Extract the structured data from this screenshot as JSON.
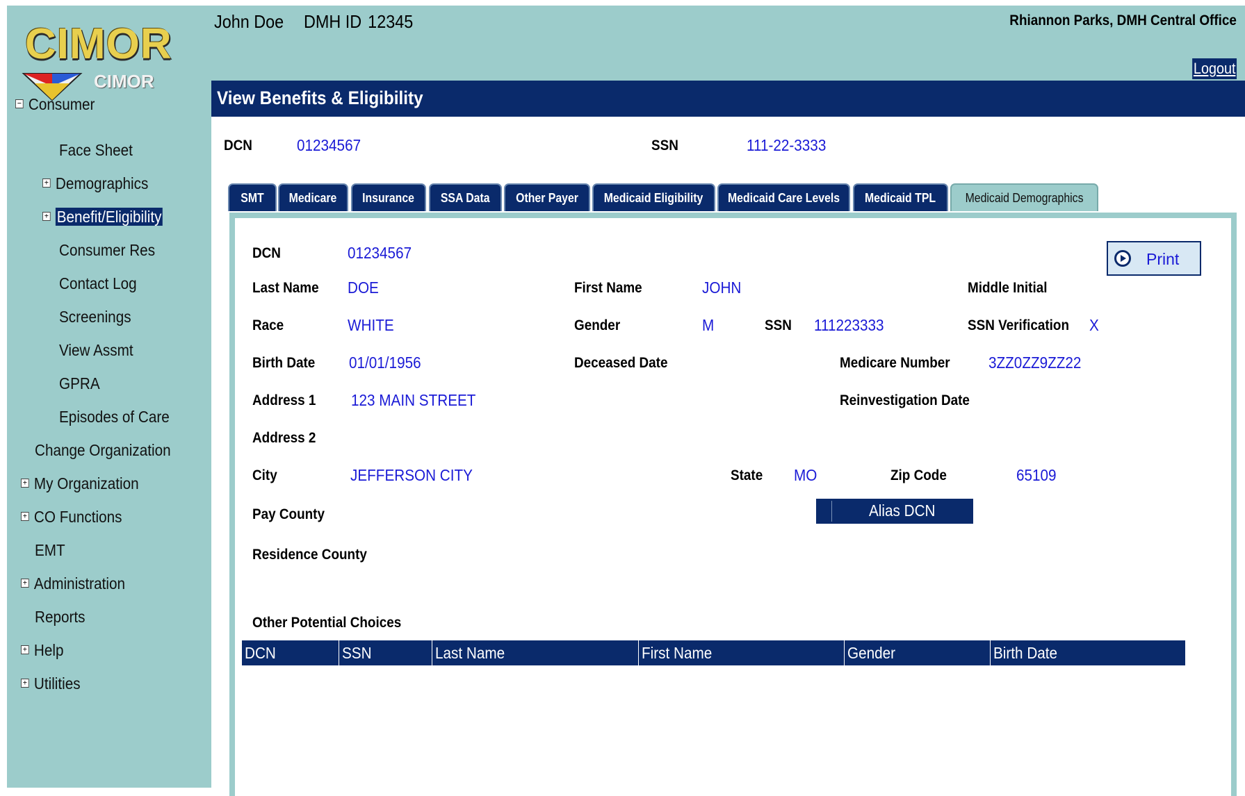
{
  "app": {
    "logo_text": "CIMOR",
    "logo_subtext": "CIMOR"
  },
  "header": {
    "consumer_name": "John Doe",
    "dmh_id_label": "DMH ID",
    "dmh_id": "12345",
    "user_office": "Rhiannon Parks, DMH Central Office",
    "logout": "Logout"
  },
  "page_title": "View Benefits & Eligibility",
  "summary": {
    "dcn_label": "DCN",
    "dcn": "01234567",
    "ssn_label": "SSN",
    "ssn": "111-22-3333"
  },
  "sidebar": {
    "items": [
      {
        "label": "Consumer",
        "expander": "minus"
      },
      {
        "label": "Face Sheet",
        "expander": ""
      },
      {
        "label": "Demographics",
        "expander": "plus"
      },
      {
        "label": "Benefit/Eligibility",
        "expander": "plus",
        "selected": true
      },
      {
        "label": "Consumer Res",
        "expander": ""
      },
      {
        "label": "Contact Log",
        "expander": ""
      },
      {
        "label": "Screenings",
        "expander": ""
      },
      {
        "label": "View Assmt",
        "expander": ""
      },
      {
        "label": "GPRA",
        "expander": ""
      },
      {
        "label": "Episodes of Care",
        "expander": ""
      },
      {
        "label": "Change Organization",
        "expander": ""
      },
      {
        "label": "My Organization",
        "expander": "plus"
      },
      {
        "label": "CO Functions",
        "expander": "plus"
      },
      {
        "label": "EMT",
        "expander": ""
      },
      {
        "label": "Administration",
        "expander": "plus"
      },
      {
        "label": "Reports",
        "expander": ""
      },
      {
        "label": "Help",
        "expander": "plus"
      },
      {
        "label": "Utilities",
        "expander": "plus"
      }
    ]
  },
  "tabs": [
    {
      "label": "SMT"
    },
    {
      "label": "Medicare"
    },
    {
      "label": "Insurance"
    },
    {
      "label": "SSA Data"
    },
    {
      "label": "Other Payer"
    },
    {
      "label": "Medicaid Eligibility"
    },
    {
      "label": "Medicaid Care Levels"
    },
    {
      "label": "Medicaid TPL"
    },
    {
      "label": "Medicaid Demographics",
      "active": true
    }
  ],
  "detail": {
    "dcn_label": "DCN",
    "dcn": "01234567",
    "last_name_label": "Last Name",
    "last_name": "DOE",
    "first_name_label": "First Name",
    "first_name": "JOHN",
    "middle_initial_label": "Middle Initial",
    "middle_initial": "",
    "race_label": "Race",
    "race": "WHITE",
    "gender_label": "Gender",
    "gender": "M",
    "ssn_label": "SSN",
    "ssn": "111223333",
    "ssn_verification_label": "SSN Verification",
    "ssn_verification": "X",
    "birth_date_label": "Birth Date",
    "birth_date": "01/01/1956",
    "deceased_date_label": "Deceased Date",
    "deceased_date": "",
    "medicare_number_label": "Medicare Number",
    "medicare_number": "3ZZ0ZZ9ZZ22",
    "address1_label": "Address 1",
    "address1": "123 MAIN STREET",
    "reinvestigation_date_label": "Reinvestigation Date",
    "reinvestigation_date": "",
    "address2_label": "Address 2",
    "address2": "",
    "city_label": "City",
    "city": "JEFFERSON CITY",
    "state_label": "State",
    "state": "MO",
    "zip_label": "Zip Code",
    "zip": "65109",
    "pay_county_label": "Pay County",
    "pay_county": "",
    "residence_county_label": "Residence County",
    "residence_county": "",
    "print_label": "Print",
    "alias_dcn_label": "Alias DCN",
    "other_choices_label": "Other Potential Choices"
  },
  "other_choices_table": {
    "columns": [
      "DCN",
      "SSN",
      "Last Name",
      "First Name",
      "Gender",
      "Birth Date"
    ],
    "rows": []
  },
  "colors": {
    "sidebar_bg": "#9ccccb",
    "navy": "#0a2a6b",
    "value_text": "#1a1ad6"
  }
}
